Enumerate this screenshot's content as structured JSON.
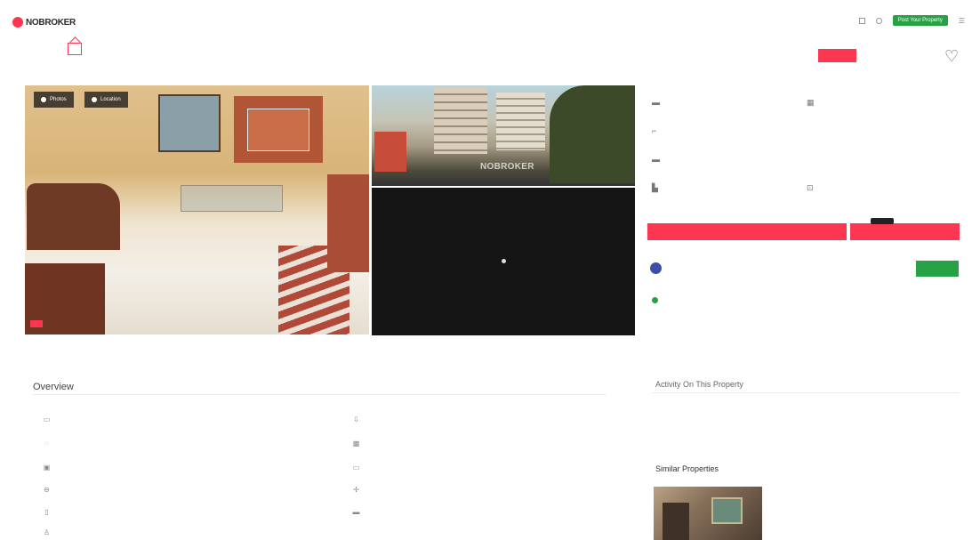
{
  "header": {
    "logo_text": "NOBROKER"
  },
  "topnav": {
    "post_property": "Post Your Property"
  },
  "photos": {
    "photos_tab": "Photos",
    "location_tab": "Location",
    "watermark": "NOBROKER"
  },
  "details": [
    {
      "icon": "bedroom-icon"
    },
    {
      "icon": "calendar-icon"
    },
    {
      "icon": "bathroom-icon"
    },
    {
      "icon": "furnishing-icon"
    },
    {
      "icon": "parking-icon"
    },
    {
      "icon": "society-icon"
    },
    {
      "icon": "parking-car-icon"
    },
    {
      "icon": "floor-icon"
    }
  ],
  "overview": {
    "title": "Overview",
    "items": [
      {
        "icon": "building-icon"
      },
      {
        "icon": "lease-icon"
      },
      {
        "icon": "maintenance-icon"
      },
      {
        "icon": "flooring-icon"
      },
      {
        "icon": "area-icon"
      },
      {
        "icon": "carpet-icon"
      },
      {
        "icon": "furnishing-icon"
      },
      {
        "icon": "facing-icon"
      },
      {
        "icon": "floor-icon"
      },
      {
        "icon": "parking-icon"
      },
      {
        "icon": "age-icon"
      }
    ]
  },
  "activity": {
    "title": "Activity On This Property"
  },
  "similar": {
    "title": "Similar Properties"
  },
  "colors": {
    "brand": "#fd3752",
    "green": "#26a245",
    "package_blue": "#3b4fa8"
  }
}
